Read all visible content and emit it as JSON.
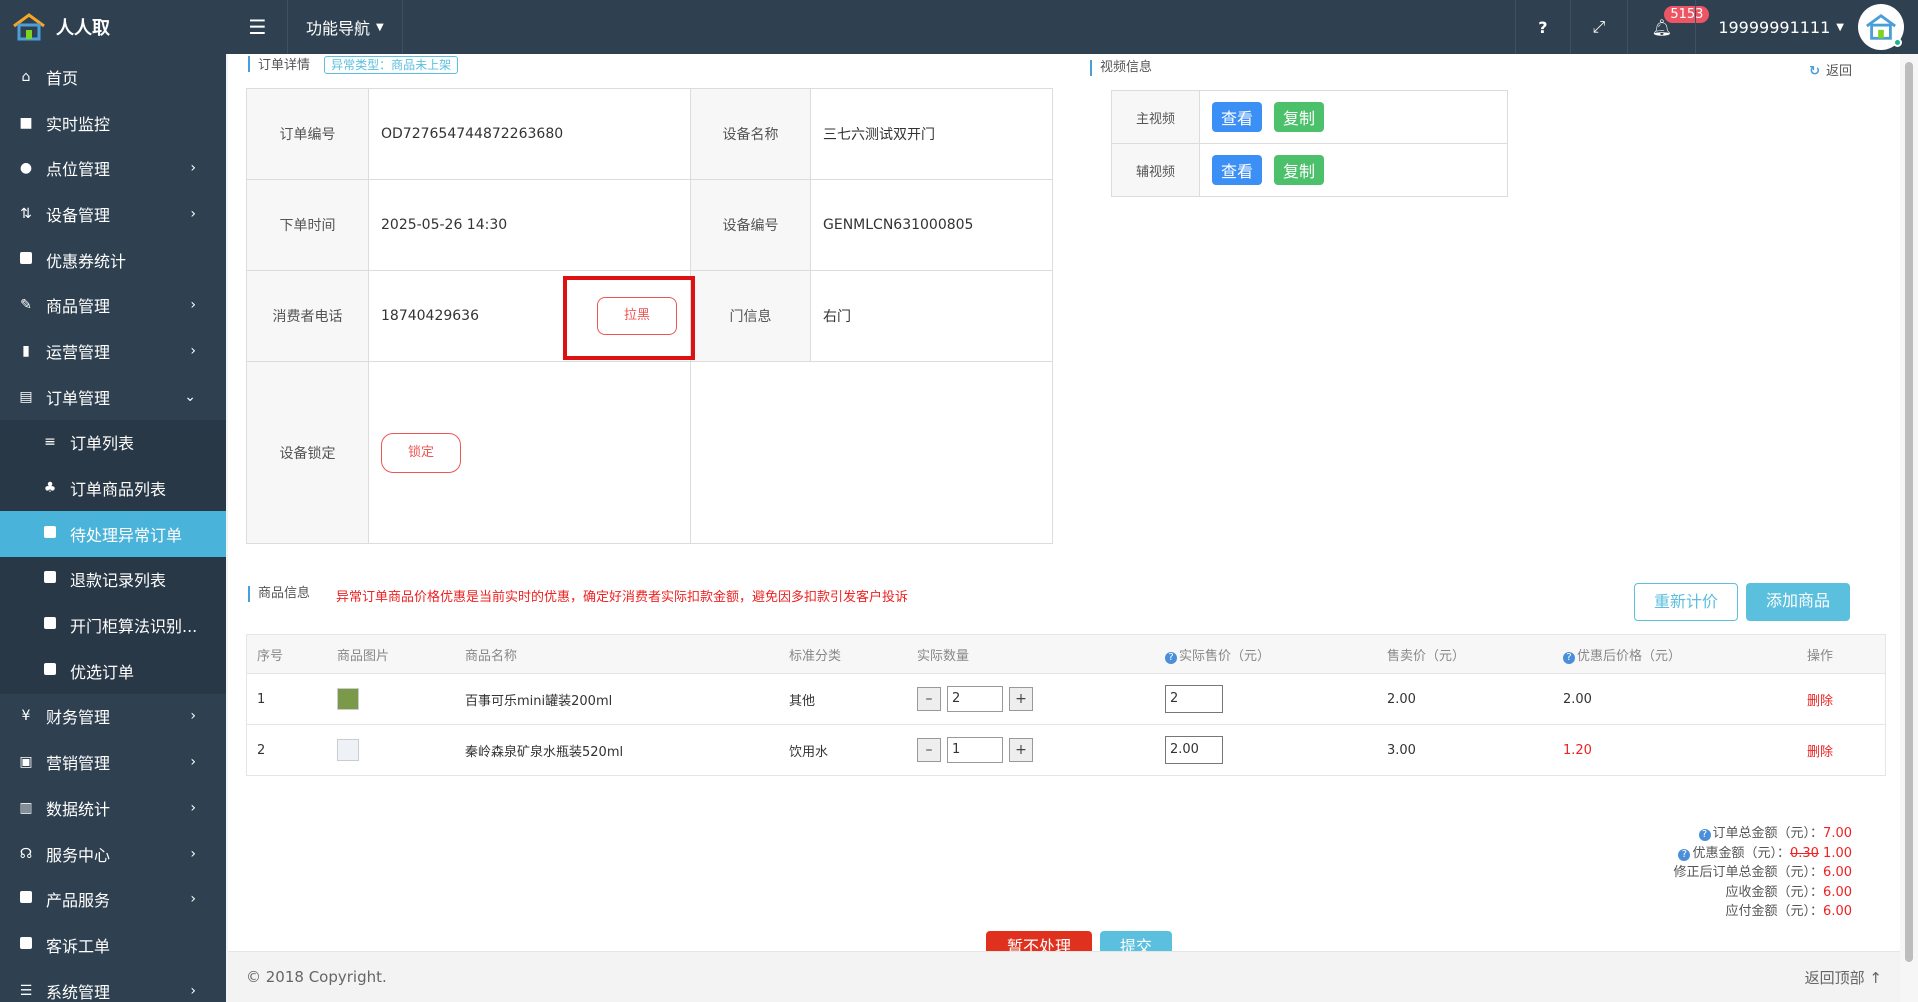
{
  "app": {
    "name": "人人取"
  },
  "topbar": {
    "func_nav": "功能导航",
    "help": "?",
    "notif_count": "5153",
    "user": "19999991111"
  },
  "sidebar": {
    "items": [
      {
        "label": "首页",
        "icon": "home-icon",
        "glyph": "⌂"
      },
      {
        "label": "实时监控",
        "icon": "video-camera-icon",
        "glyph": "■"
      },
      {
        "label": "点位管理",
        "icon": "map-marker-icon",
        "glyph": "●"
      },
      {
        "label": "设备管理",
        "icon": "sort-icon",
        "glyph": "⇅"
      },
      {
        "label": "优惠券统计",
        "icon": "square-icon",
        "glyph": ""
      },
      {
        "label": "商品管理",
        "icon": "edit-icon",
        "glyph": "✎"
      },
      {
        "label": "运营管理",
        "icon": "bookmark-icon",
        "glyph": "▮"
      },
      {
        "label": "订单管理",
        "icon": "list-icon",
        "glyph": "▤"
      }
    ],
    "sub_items": [
      {
        "label": "订单列表",
        "glyph": "≡"
      },
      {
        "label": "订单商品列表",
        "glyph": "♣"
      },
      {
        "label": "待处理异常订单",
        "glyph": ""
      },
      {
        "label": "退款记录列表",
        "glyph": ""
      },
      {
        "label": "开门柜算法识别...",
        "glyph": ""
      },
      {
        "label": "优选订单",
        "glyph": ""
      }
    ],
    "items_after": [
      {
        "label": "财务管理",
        "glyph": "¥"
      },
      {
        "label": "营销管理",
        "glyph": "▣"
      },
      {
        "label": "数据统计",
        "glyph": "▥"
      },
      {
        "label": "服务中心",
        "glyph": "☊"
      },
      {
        "label": "产品服务",
        "glyph": ""
      },
      {
        "label": "客诉工单",
        "glyph": ""
      },
      {
        "label": "系统管理",
        "glyph": "☰"
      }
    ]
  },
  "order_detail": {
    "section_title": "订单详情",
    "type_tag": "异常类型：商品未上架",
    "order_no_label": "订单编号",
    "order_no": "OD727654744872263680",
    "device_name_label": "设备名称",
    "device_name": "三七六测试双开门",
    "order_time_label": "下单时间",
    "order_time": "2025-05-26 14:30",
    "device_no_label": "设备编号",
    "device_no": "GENMLCN631000805",
    "phone_label": "消费者电话",
    "phone": "18740429636",
    "blacklist_btn": "拉黑",
    "door_label": "门信息",
    "door": "右门",
    "lock_label": "设备锁定",
    "lock_btn": "锁定"
  },
  "video": {
    "section_title": "视频信息",
    "back": "返回",
    "main_label": "主视频",
    "sub_label": "辅视频",
    "view_btn": "查看",
    "copy_btn": "复制"
  },
  "goods": {
    "section_title": "商品信息",
    "warning": "异常订单商品价格优惠是当前实时的优惠，确定好消费者实际扣款金额，避免因多扣款引发客户投诉",
    "reprice_btn": "重新计价",
    "add_btn": "添加商品",
    "headers": {
      "no": "序号",
      "img": "商品图片",
      "name": "商品名称",
      "category": "标准分类",
      "qty": "实际数量",
      "actual_price": "实际售价（元）",
      "price": "售卖价（元）",
      "discount_price": "优惠后价格（元）",
      "op": "操作"
    },
    "rows": [
      {
        "no": "1",
        "name": "百事可乐mini罐装200ml",
        "category": "其他",
        "qty": "2",
        "actual_price": "2",
        "price": "2.00",
        "discount_price": "2.00",
        "op": "删除"
      },
      {
        "no": "2",
        "name": "秦岭森泉矿泉水瓶装520ml",
        "category": "饮用水",
        "qty": "1",
        "actual_price": "2.00",
        "price": "3.00",
        "discount_price": "1.20",
        "op": "删除"
      }
    ]
  },
  "summary": {
    "total_label": "订单总金额（元）：",
    "total": "7.00",
    "discount_label": "优惠金额（元）：",
    "discount_old": "0.30",
    "discount": "1.00",
    "corrected_label": "修正后订单总金额（元）：",
    "corrected": "6.00",
    "receivable_label": "应收金额（元）：",
    "receivable": "6.00",
    "payable_label": "应付金额（元）：",
    "payable": "6.00"
  },
  "actions": {
    "ignore": "暂不处理",
    "submit": "提交"
  },
  "footer": {
    "copyright": "© 2018 Copyright.",
    "back_top": "返回顶部"
  },
  "colors": {
    "sidebar": "#2f4050",
    "active": "#4ab3d9",
    "danger": "#e22222",
    "primary": "#3b8ff5",
    "success": "#4cc06b"
  }
}
